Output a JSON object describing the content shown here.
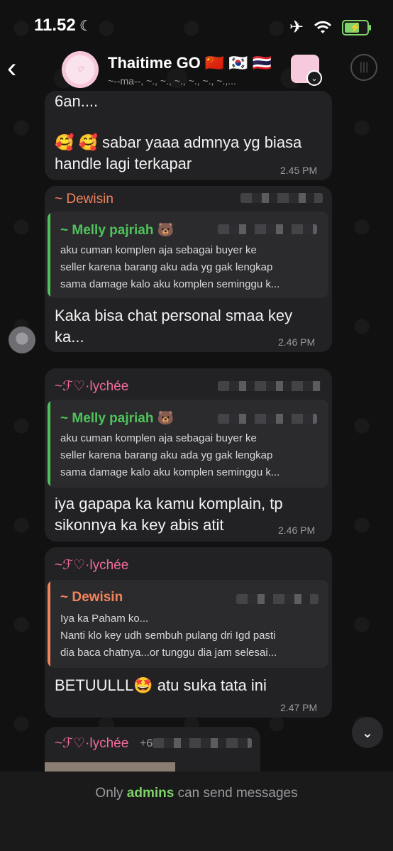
{
  "status_bar": {
    "time": "11.52"
  },
  "header": {
    "back_icon": "chevron-left-icon",
    "title": "Thaitime GO 🇨🇳 🇰🇷 🇹🇭",
    "subtitle": "~--ma--, ~., ~., ~., ~., ~., ~.,..."
  },
  "messages": [
    {
      "text_line1": "6an....",
      "text_line2": "🥰 🥰 sabar yaaa admnya yg biasa",
      "text_line3": "handle lagi terkapar",
      "time": "2.45 PM"
    },
    {
      "sender": "~ Dewisin",
      "reply": {
        "name": "~ Melly pajriah 🐻",
        "line1": "aku cuman komplen aja sebagai buyer ke",
        "line2": "seller karena barang aku ada yg gak lengkap",
        "line3": "sama damage kalo aku komplen seminggu k..."
      },
      "text_line1": "Kaka bisa chat personal smaa key",
      "text_line2": "ka...",
      "time": "2.46 PM"
    },
    {
      "sender": "~ℱ♡·lychée",
      "reply": {
        "name": "~ Melly pajriah 🐻",
        "line1": "aku cuman komplen aja sebagai buyer ke",
        "line2": "seller karena barang aku ada yg gak lengkap",
        "line3": "sama damage kalo aku komplen seminggu k..."
      },
      "text_line1": "iya gapapa ka kamu komplain, tp",
      "text_line2": "sikonnya ka key abis atit",
      "time": "2.46 PM"
    },
    {
      "sender": "~ℱ♡·lychée",
      "reply": {
        "name": "~ Dewisin",
        "line1": "Iya ka Paham ko...",
        "line2": "Nanti klo key udh sembuh pulang dri Igd pasti",
        "line3": "dia baca chatnya...or tunggu dia jam selesai..."
      },
      "text_line1": "BETUULLL🤩 atu suka tata ini",
      "time": "2.47 PM"
    },
    {
      "sender": "~ℱ♡·lychée",
      "phone_prefix": "+6"
    }
  ],
  "footer": {
    "prefix": "Only ",
    "highlight": "admins",
    "suffix": " can send messages"
  },
  "colors": {
    "accent_green": "#7fd36a",
    "sender_pink": "#f06a9a",
    "sender_orange": "#f2845c",
    "reply_green": "#4fc35a"
  }
}
